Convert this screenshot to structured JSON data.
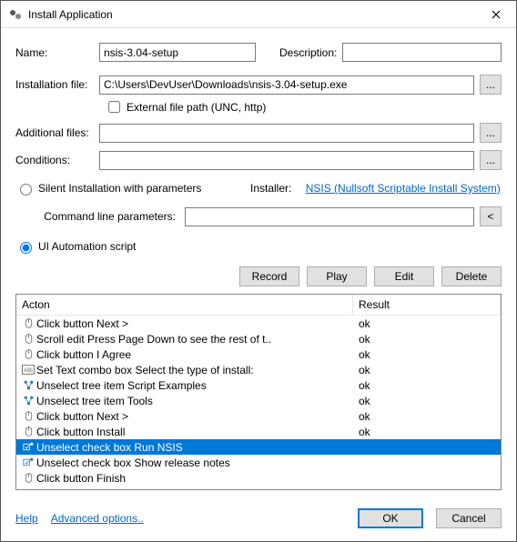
{
  "title": "Install Application",
  "labels": {
    "name": "Name:",
    "description": "Description:",
    "installation_file": "Installation file:",
    "external_path": "External file path (UNC, http)",
    "additional_files": "Additional files:",
    "conditions": "Conditions:",
    "silent_radio": "Silent Installation with parameters",
    "installer": "Installer:",
    "installer_link": "NSIS (Nullsoft Scriptable Install System)",
    "cmd_params": "Command line parameters:",
    "ui_radio": "UI Automation script",
    "record": "Record",
    "play": "Play",
    "edit": "Edit",
    "delete": "Delete",
    "browse": "...",
    "collapse": "<",
    "help": "Help",
    "advanced": "Advanced options..",
    "ok": "OK",
    "cancel": "Cancel"
  },
  "values": {
    "name": "nsis-3.04-setup",
    "description": "",
    "installation_file": "C:\\Users\\DevUser\\Downloads\\nsis-3.04-setup.exe",
    "external_checked": false,
    "additional_files": "",
    "conditions": "",
    "silent_selected": false,
    "ui_selected": true,
    "cmd_params": ""
  },
  "columns": {
    "action": "Acton",
    "result": "Result"
  },
  "rows": [
    {
      "icon": "mouse",
      "action": "Click button Next >",
      "result": "ok",
      "selected": false
    },
    {
      "icon": "mouse",
      "action": "Scroll edit Press Page Down to see the rest of t..",
      "result": "ok",
      "selected": false
    },
    {
      "icon": "mouse",
      "action": "Click button I Agree",
      "result": "ok",
      "selected": false
    },
    {
      "icon": "abi",
      "action": "Set Text combo box Select the type of install:",
      "result": "ok",
      "selected": false
    },
    {
      "icon": "tree",
      "action": "Unselect tree item Script Examples",
      "result": "ok",
      "selected": false
    },
    {
      "icon": "tree",
      "action": "Unselect tree item Tools",
      "result": "ok",
      "selected": false
    },
    {
      "icon": "mouse",
      "action": "Click button Next >",
      "result": "ok",
      "selected": false
    },
    {
      "icon": "mouse",
      "action": "Click button Install",
      "result": "ok",
      "selected": false
    },
    {
      "icon": "check",
      "action": "Unselect check box Run NSIS",
      "result": "",
      "selected": true
    },
    {
      "icon": "check",
      "action": "Unselect check box Show release notes",
      "result": "",
      "selected": false
    },
    {
      "icon": "mouse",
      "action": "Click button Finish",
      "result": "",
      "selected": false
    }
  ]
}
